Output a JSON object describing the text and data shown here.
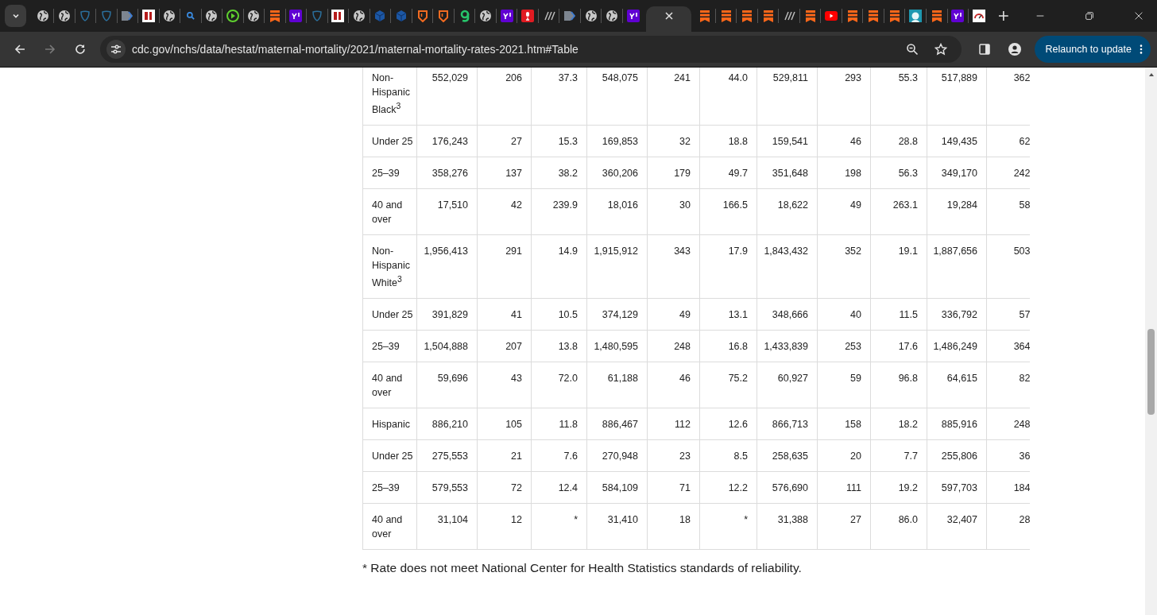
{
  "tabs": [
    {
      "kind": "globe",
      "selected": false
    },
    {
      "kind": "globe",
      "selected": false
    },
    {
      "kind": "shield",
      "selected": false
    },
    {
      "kind": "shield",
      "selected": false
    },
    {
      "kind": "chevron",
      "selected": false
    },
    {
      "kind": "bi",
      "selected": false
    },
    {
      "kind": "globe",
      "selected": false
    },
    {
      "kind": "search",
      "selected": false
    },
    {
      "kind": "globe",
      "selected": false
    },
    {
      "kind": "play",
      "selected": false
    },
    {
      "kind": "globe",
      "selected": false
    },
    {
      "kind": "bookmark",
      "selected": false
    },
    {
      "kind": "purple",
      "selected": false
    },
    {
      "kind": "shield",
      "selected": false
    },
    {
      "kind": "bi",
      "selected": false
    },
    {
      "kind": "globe",
      "selected": false
    },
    {
      "kind": "cube",
      "selected": false
    },
    {
      "kind": "cube",
      "selected": false
    },
    {
      "kind": "badge",
      "selected": false
    },
    {
      "kind": "badge",
      "selected": false
    },
    {
      "kind": "leaf",
      "selected": false
    },
    {
      "kind": "globe",
      "selected": false
    },
    {
      "kind": "purple",
      "selected": false
    },
    {
      "kind": "mic",
      "selected": false
    },
    {
      "kind": "slash",
      "selected": false
    },
    {
      "kind": "chevron",
      "selected": false
    },
    {
      "kind": "globe",
      "selected": false
    },
    {
      "kind": "globe",
      "selected": false
    },
    {
      "kind": "purple",
      "selected": false
    },
    {
      "selected": true
    },
    {
      "kind": "bookmark",
      "selected": false
    },
    {
      "kind": "bookmark",
      "selected": false
    },
    {
      "kind": "bookmark",
      "selected": false
    },
    {
      "kind": "bookmark",
      "selected": false
    },
    {
      "kind": "slash",
      "selected": false
    },
    {
      "kind": "bookmark",
      "selected": false
    },
    {
      "kind": "video",
      "selected": false
    },
    {
      "kind": "bookmark",
      "selected": false
    },
    {
      "kind": "bookmark",
      "selected": false
    },
    {
      "kind": "bookmark",
      "selected": false
    },
    {
      "kind": "teal",
      "selected": false
    },
    {
      "kind": "bookmark",
      "selected": false
    },
    {
      "kind": "purple",
      "selected": false
    },
    {
      "kind": "gauge",
      "selected": false
    }
  ],
  "address_bar": {
    "url": "cdc.gov/nchs/data/hestat/maternal-mortality/2021/maternal-mortality-rates-2021.htm#Table"
  },
  "update_button": "Relaunch to update",
  "table": {
    "rows": [
      {
        "label": "Non-Hispanic Black$^{3}$",
        "cells": [
          "552,029",
          "206",
          "37.3",
          "548,075",
          "241",
          "44.0",
          "529,811",
          "293",
          "55.3",
          "517,889",
          "362"
        ]
      },
      {
        "label": "Under 25",
        "cells": [
          "176,243",
          "27",
          "15.3",
          "169,853",
          "32",
          "18.8",
          "159,541",
          "46",
          "28.8",
          "149,435",
          "62"
        ]
      },
      {
        "label": "25–39",
        "cells": [
          "358,276",
          "137",
          "38.2",
          "360,206",
          "179",
          "49.7",
          "351,648",
          "198",
          "56.3",
          "349,170",
          "242"
        ]
      },
      {
        "label": "40 and over",
        "cells": [
          "17,510",
          "42",
          "239.9",
          "18,016",
          "30",
          "166.5",
          "18,622",
          "49",
          "263.1",
          "19,284",
          "58"
        ]
      },
      {
        "label": "Non-Hispanic White$^{3}$",
        "cells": [
          "1,956,413",
          "291",
          "14.9",
          "1,915,912",
          "343",
          "17.9",
          "1,843,432",
          "352",
          "19.1",
          "1,887,656",
          "503"
        ]
      },
      {
        "label": "Under 25",
        "cells": [
          "391,829",
          "41",
          "10.5",
          "374,129",
          "49",
          "13.1",
          "348,666",
          "40",
          "11.5",
          "336,792",
          "57"
        ]
      },
      {
        "label": "25–39",
        "cells": [
          "1,504,888",
          "207",
          "13.8",
          "1,480,595",
          "248",
          "16.8",
          "1,433,839",
          "253",
          "17.6",
          "1,486,249",
          "364"
        ]
      },
      {
        "label": "40 and over",
        "cells": [
          "59,696",
          "43",
          "72.0",
          "61,188",
          "46",
          "75.2",
          "60,927",
          "59",
          "96.8",
          "64,615",
          "82"
        ]
      },
      {
        "label": "Hispanic",
        "cells": [
          "886,210",
          "105",
          "11.8",
          "886,467",
          "112",
          "12.6",
          "866,713",
          "158",
          "18.2",
          "885,916",
          "248"
        ]
      },
      {
        "label": "Under 25",
        "cells": [
          "275,553",
          "21",
          "7.6",
          "270,948",
          "23",
          "8.5",
          "258,635",
          "20",
          "7.7",
          "255,806",
          "36"
        ]
      },
      {
        "label": "25–39",
        "cells": [
          "579,553",
          "72",
          "12.4",
          "584,109",
          "71",
          "12.2",
          "576,690",
          "111",
          "19.2",
          "597,703",
          "184"
        ]
      },
      {
        "label": "40 and over",
        "cells": [
          "31,104",
          "12",
          "*",
          "31,410",
          "18",
          "*",
          "31,388",
          "27",
          "86.0",
          "32,407",
          "28"
        ]
      }
    ]
  },
  "footnote": "* Rate does not meet National Center for Health Statistics standards of reliability."
}
